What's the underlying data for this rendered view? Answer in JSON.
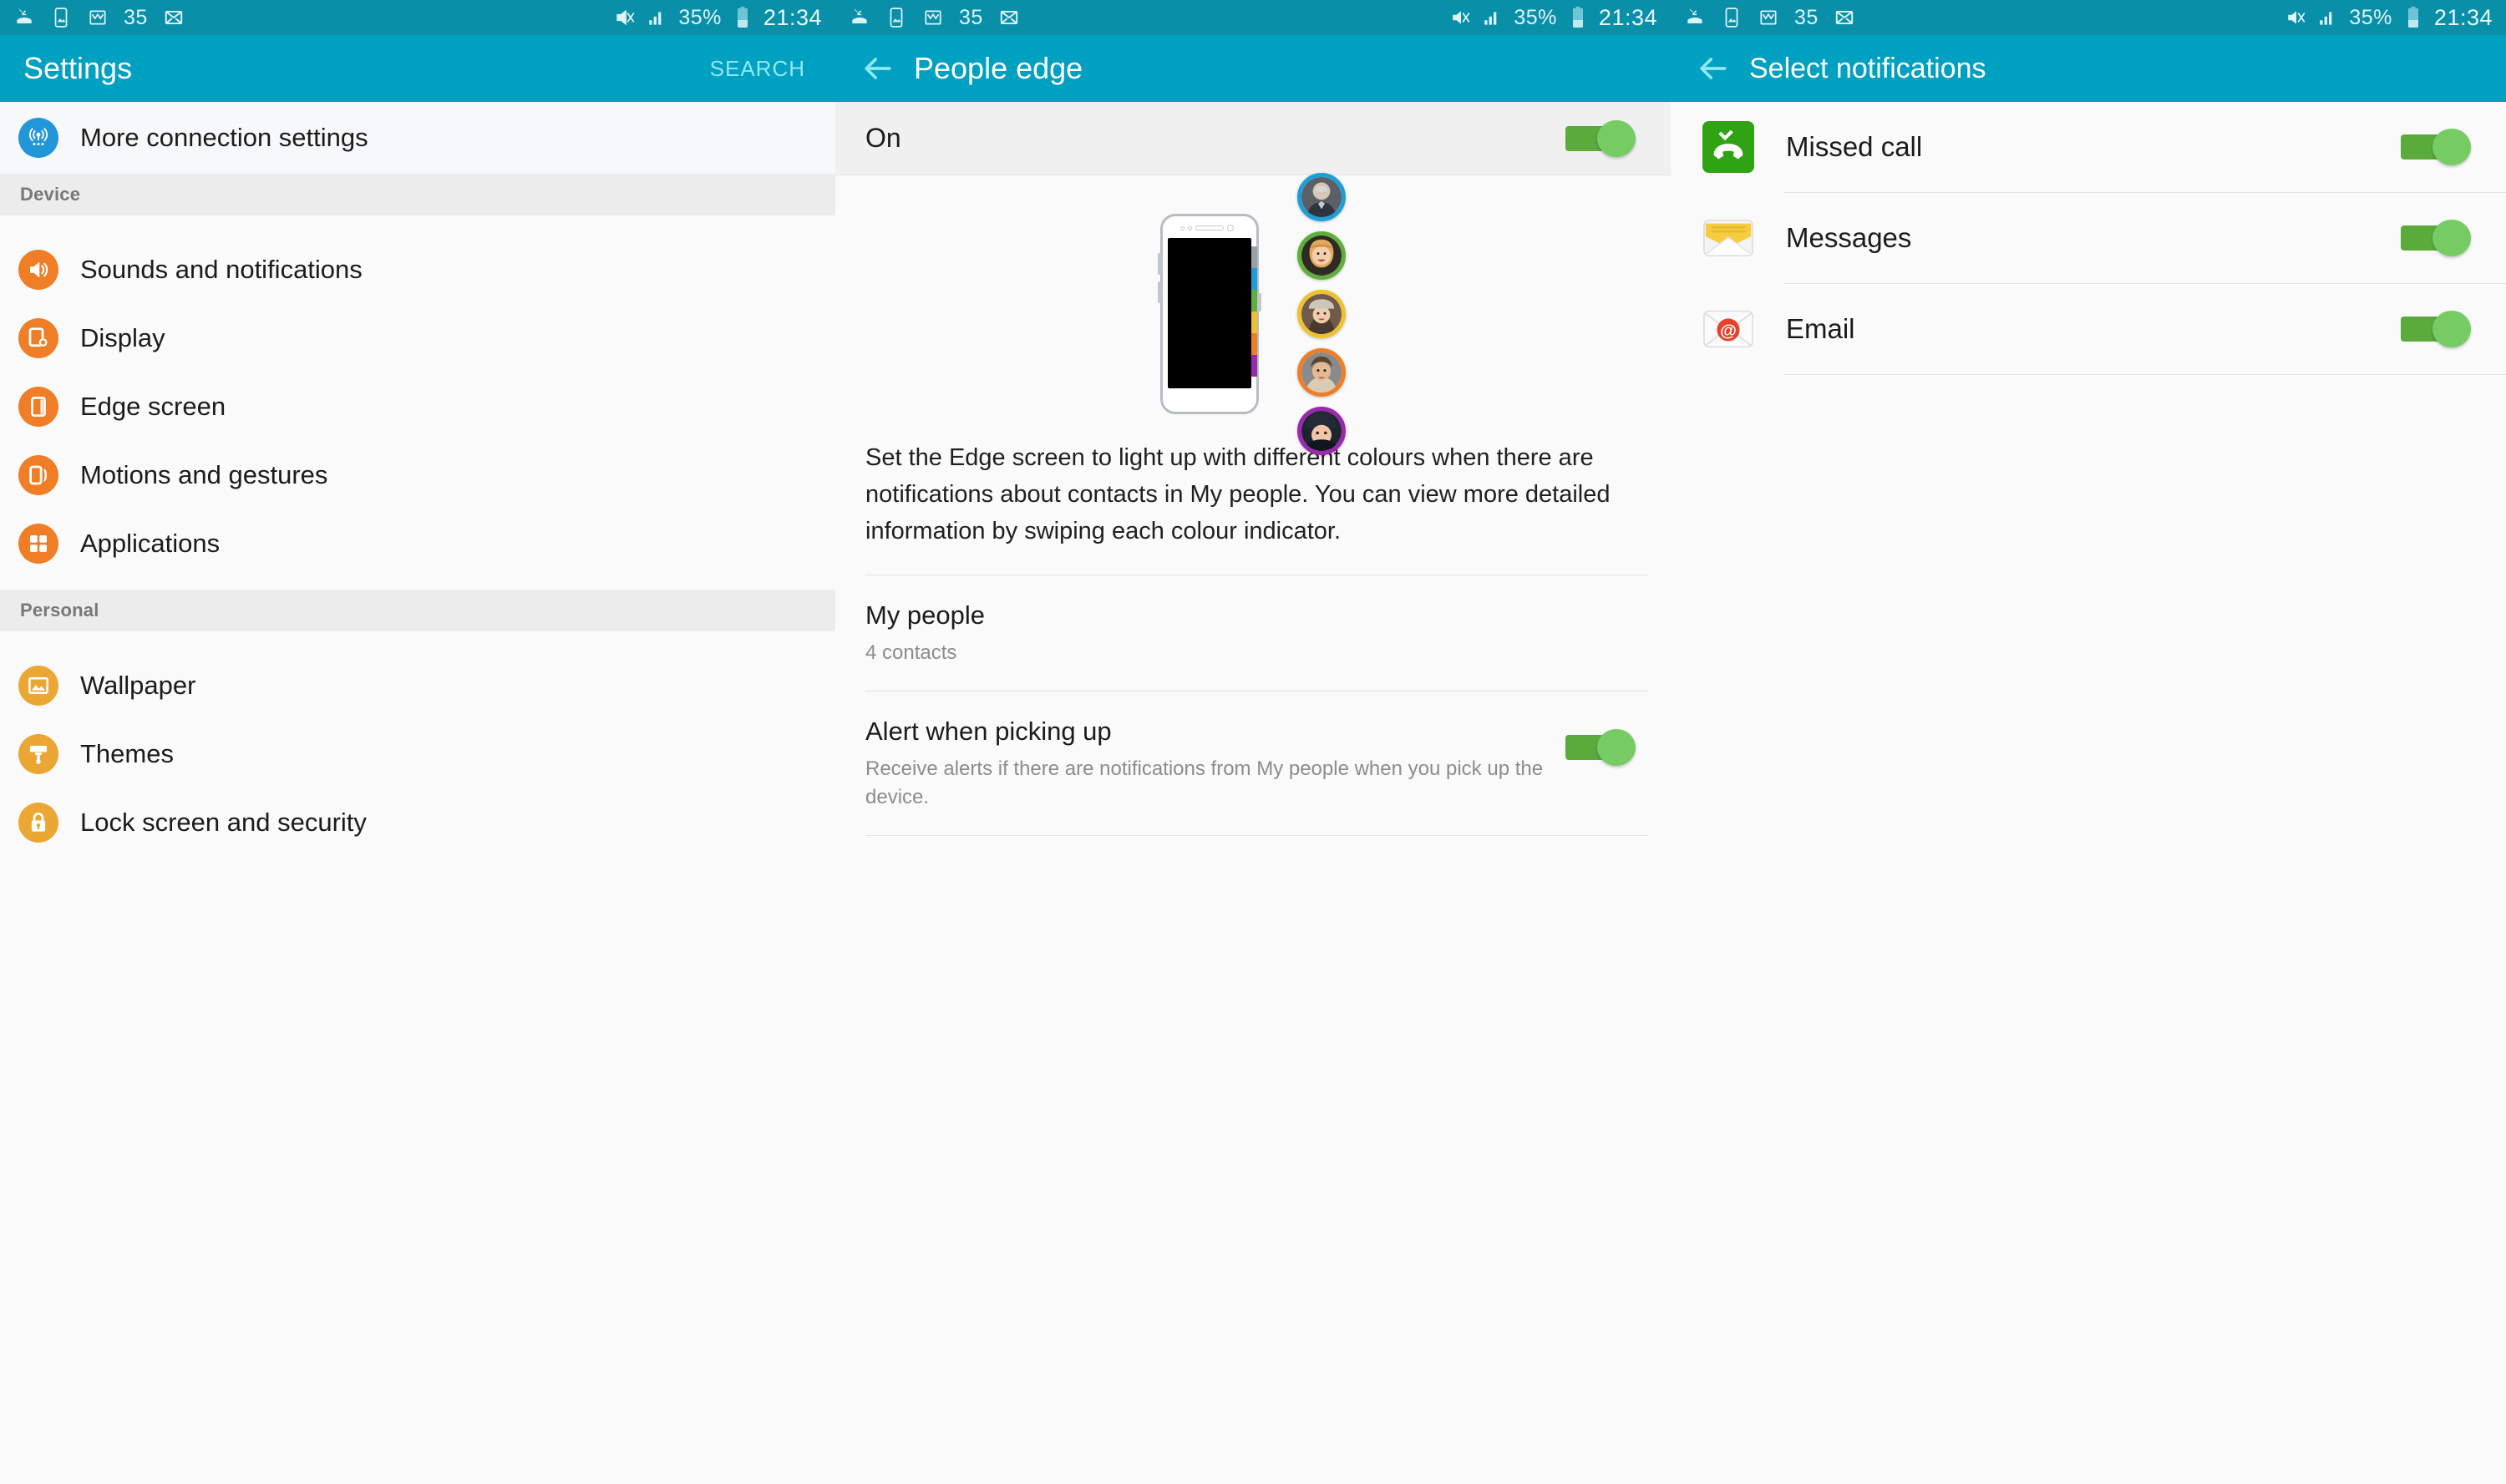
{
  "colors": {
    "statusbar_bg": "#0a8fa8",
    "appbar_bg": "#00a0c0",
    "accent_blue": "#2196d8",
    "orange": "#ef7e27",
    "amber": "#eaa733",
    "toggle_on_track": "#5aaa3c",
    "toggle_on_knob": "#76cc62",
    "green_phone": "#2fa314",
    "email_red": "#e8402a",
    "messages_yellow": "#f7cc3f"
  },
  "statusbar": {
    "icons": [
      "missed-call-icon",
      "screenshot-icon",
      "gmail-icon",
      "mail-icon"
    ],
    "notification_count": "35",
    "right_icons": [
      "vibrate-mute-icon",
      "signal-bars-icon",
      "battery-icon"
    ],
    "battery_percent": "35%",
    "time": "21:34"
  },
  "panel_settings": {
    "title": "Settings",
    "search_label": "SEARCH",
    "rows": [
      {
        "label": "More connection settings",
        "icon": "more-connections-icon",
        "icon_color": "#2196d8",
        "highlighted": true
      }
    ],
    "sections": [
      {
        "header": "Device",
        "items": [
          {
            "label": "Sounds and notifications",
            "icon": "volume-icon",
            "icon_color": "#ef7e27"
          },
          {
            "label": "Display",
            "icon": "display-icon",
            "icon_color": "#ef7e27"
          },
          {
            "label": "Edge screen",
            "icon": "edge-screen-icon",
            "icon_color": "#ef7e27"
          },
          {
            "label": "Motions and gestures",
            "icon": "motions-icon",
            "icon_color": "#ef7e27"
          },
          {
            "label": "Applications",
            "icon": "applications-icon",
            "icon_color": "#ef7e27"
          }
        ]
      },
      {
        "header": "Personal",
        "items": [
          {
            "label": "Wallpaper",
            "icon": "wallpaper-icon",
            "icon_color": "#eaa733"
          },
          {
            "label": "Themes",
            "icon": "themes-brush-icon",
            "icon_color": "#eaa733"
          },
          {
            "label": "Lock screen and security",
            "icon": "lock-icon",
            "icon_color": "#eaa733"
          }
        ]
      }
    ]
  },
  "panel_people_edge": {
    "title": "People edge",
    "back_icon": "back-arrow-icon",
    "master_toggle_label": "On",
    "master_toggle_state": "on",
    "illustration": {
      "phone_edge_colors": [
        "#9aa0a6",
        "#1e9ed6",
        "#5fb03a",
        "#eec22a",
        "#ef7e27",
        "#9c27b0"
      ],
      "avatar_ring_colors": [
        "#1e9ed6",
        "#5fb03a",
        "#eec22a",
        "#ef7e27",
        "#9c27b0"
      ]
    },
    "description": "Set the Edge screen to light up with different colours when there are notifications about contacts in My people. You can view more detailed information by swiping each colour indicator.",
    "my_people": {
      "title": "My people",
      "subtitle": "4 contacts"
    },
    "alert_pickup": {
      "title": "Alert when picking up",
      "subtitle": "Receive alerts if there are notifications from My people when you pick up the device.",
      "toggle_state": "on"
    }
  },
  "panel_notifications": {
    "title": "Select notifications",
    "back_icon": "back-arrow-icon",
    "rows": [
      {
        "label": "Missed call",
        "icon": "missed-call-app-icon",
        "toggle_state": "on"
      },
      {
        "label": "Messages",
        "icon": "messages-app-icon",
        "toggle_state": "on"
      },
      {
        "label": "Email",
        "icon": "email-app-icon",
        "toggle_state": "on"
      }
    ]
  }
}
